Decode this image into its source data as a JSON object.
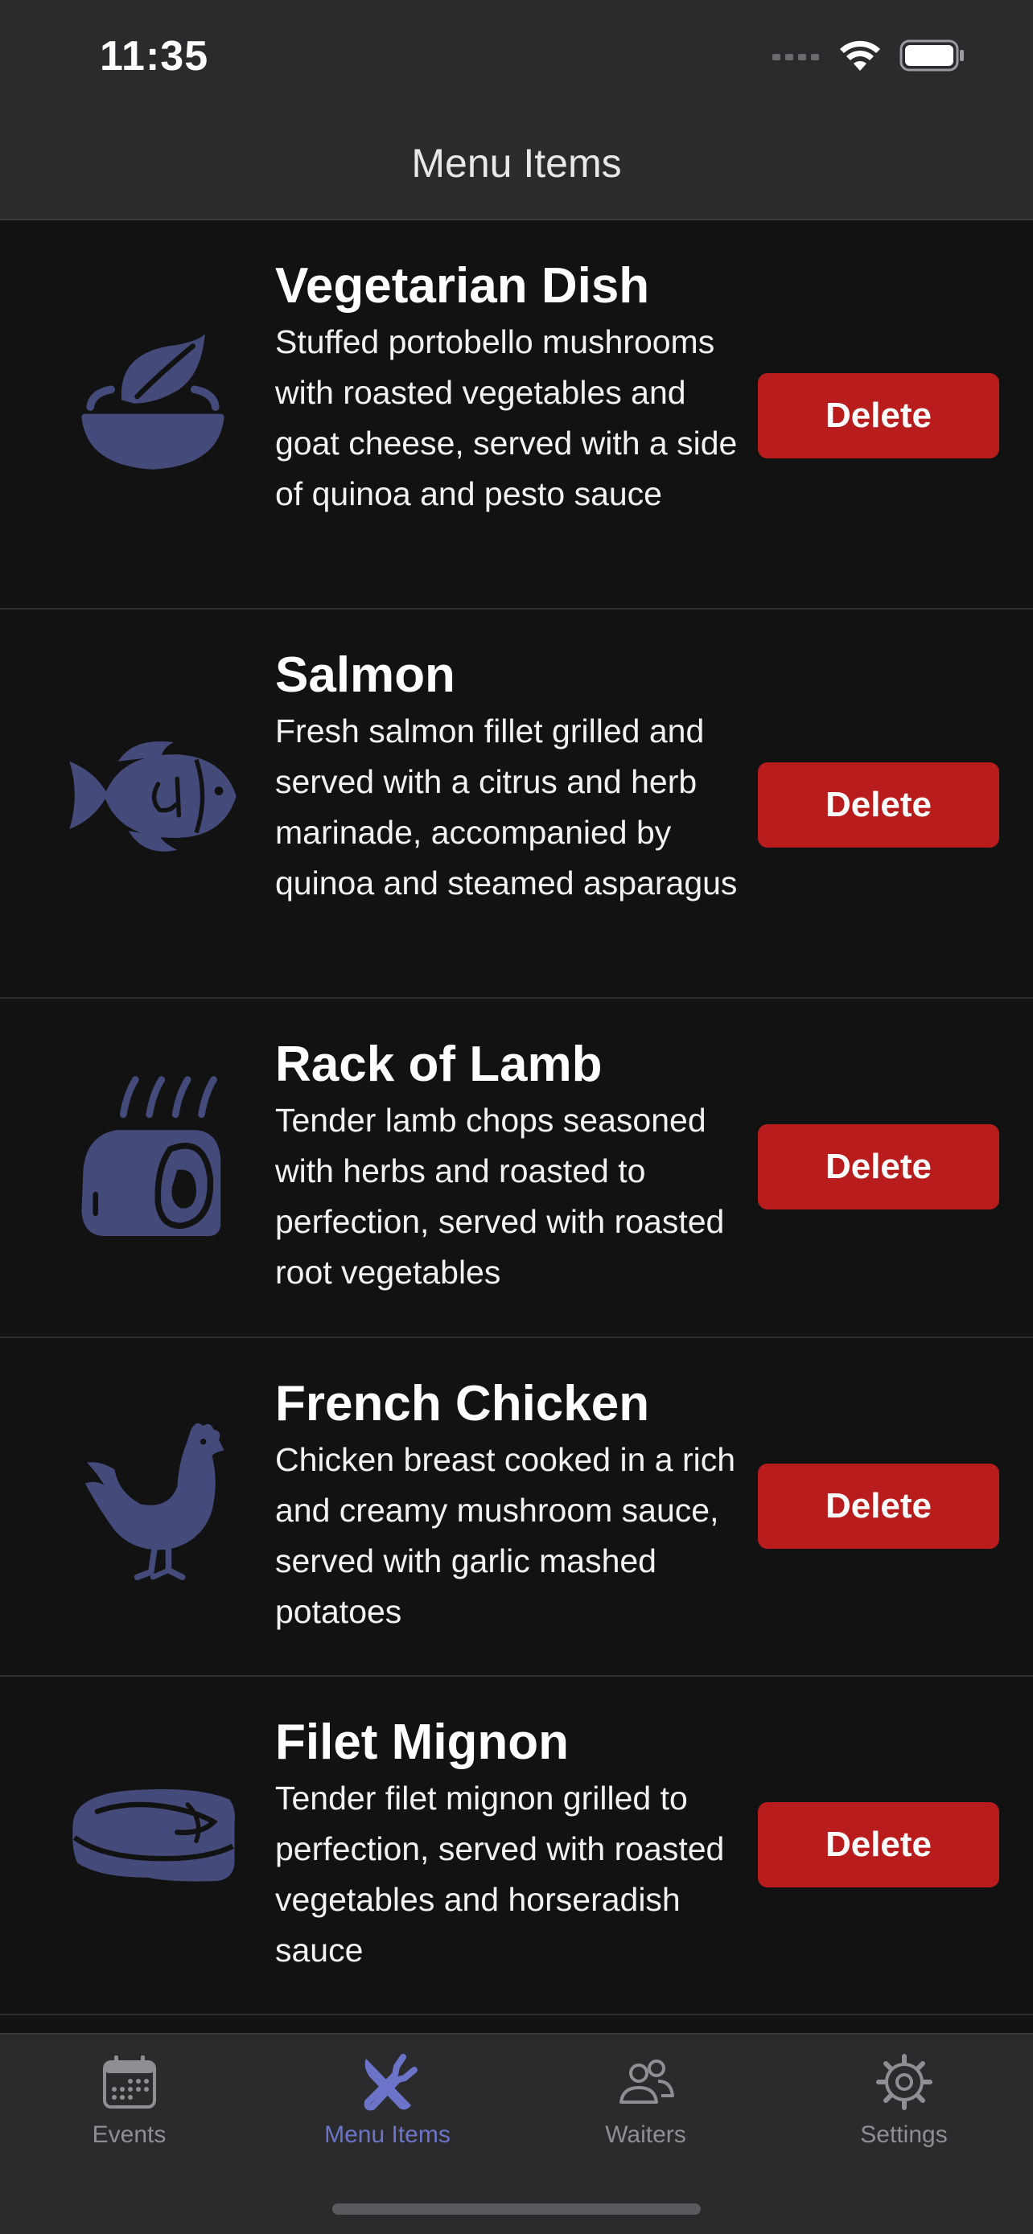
{
  "status_bar": {
    "time": "11:35"
  },
  "nav": {
    "title": "Menu Items"
  },
  "colors": {
    "icon": "#444a7a",
    "delete": "#b91c1c",
    "active_tab": "#6b74c8",
    "inactive_tab": "#8e8e93"
  },
  "menu_items": [
    {
      "title": "Vegetarian Dish",
      "description": "Stuffed portobello mushrooms with roasted vegetables and goat cheese, served with a side of quinoa and pesto sauce",
      "icon": "salad-bowl-icon",
      "delete_label": "Delete"
    },
    {
      "title": "Salmon",
      "description": "Fresh salmon fillet grilled and served with a citrus and herb marinade, accompanied by quinoa and steamed asparagus",
      "icon": "fish-icon",
      "delete_label": "Delete"
    },
    {
      "title": "Rack of Lamb",
      "description": "Tender lamb chops seasoned with herbs and roasted to perfection, served with roasted root vegetables",
      "icon": "lamb-roast-icon",
      "delete_label": "Delete"
    },
    {
      "title": "French Chicken",
      "description": "Chicken breast cooked in a rich and creamy mushroom sauce, served with garlic mashed potatoes",
      "icon": "chicken-icon",
      "delete_label": "Delete"
    },
    {
      "title": "Filet Mignon",
      "description": "Tender filet mignon grilled to perfection, served with roasted vegetables and horseradish sauce",
      "icon": "steak-icon",
      "delete_label": "Delete"
    }
  ],
  "tabs": [
    {
      "label": "Events",
      "icon": "calendar-icon",
      "active": false
    },
    {
      "label": "Menu Items",
      "icon": "fork-knife-icon",
      "active": true
    },
    {
      "label": "Waiters",
      "icon": "people-icon",
      "active": false
    },
    {
      "label": "Settings",
      "icon": "gear-icon",
      "active": false
    }
  ]
}
